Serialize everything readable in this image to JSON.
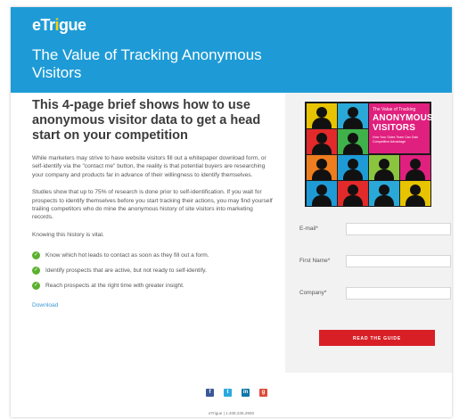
{
  "brand": {
    "logo_text": "eTrigue",
    "logo_pre": "eTr",
    "logo_accent": "i",
    "logo_post": "gue"
  },
  "hero": {
    "title": "The Value of Tracking Anonymous Visitors"
  },
  "content": {
    "headline": "This 4-page brief shows how to use anonymous visitor data to get a head start on your competition",
    "paragraphs": [
      "While marketers may strive to have website visitors fill out a whitepaper download form, or self-identify via the \"contact me\" button, the reality is that potential buyers are researching your company and products far in advance of their willingness to identify themselves.",
      "Studies show that up to 75% of research is done prior to self-identification. If you wait for prospects to identify themselves before you start tracking their actions, you may find yourself trailing competitors who do mine the anonymous history of site visitors into marketing records.",
      "Knowing this history is vital."
    ],
    "bullets": [
      "Know which hot leads to contact as soon as they fill out a form.",
      "Identify prospects that are active, but not ready to self-identify.",
      "Reach prospects at the right time with greater insight."
    ],
    "download_link": "Download"
  },
  "cover": {
    "line1": "The Value of Tracking",
    "line2": "ANONYMOUS",
    "line3": "VISITORS",
    "tagline": "How Your Sales Team Can Gain Competitive Advantage"
  },
  "form": {
    "email_label": "E-mail*",
    "first_name_label": "First Name*",
    "company_label": "Company*",
    "email_value": "",
    "first_name_value": "",
    "company_value": "",
    "submit_label": "READ THE GUIDE"
  },
  "footer": {
    "social_icons": [
      "facebook-icon",
      "twitter-icon",
      "linkedin-icon",
      "google-plus-icon"
    ],
    "contact_line": "eTrigue | 1.408.236.2900"
  },
  "colors": {
    "hero_bg": "#1e9bd6",
    "cta_bg": "#d81f26",
    "check_green": "#5bb12f",
    "cover_pink": "#e0207e",
    "link_blue": "#3c97d3"
  }
}
